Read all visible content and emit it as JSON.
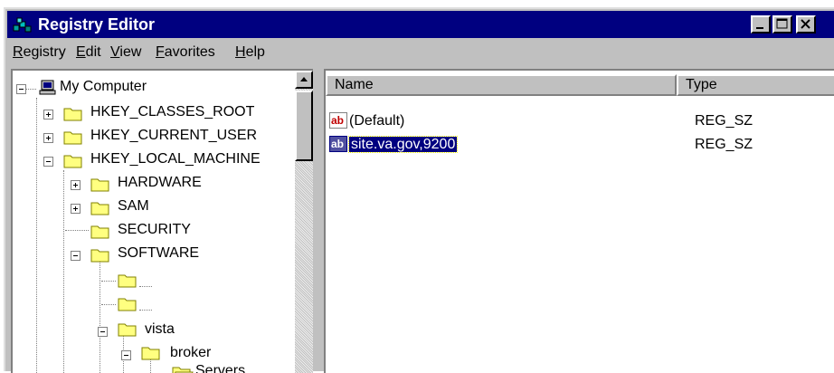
{
  "window": {
    "title": "Registry Editor",
    "app_icon": "registry-editor-icon"
  },
  "title_buttons": [
    "minimize-icon",
    "maximize-icon",
    "close-icon"
  ],
  "menu": [
    {
      "pre": "",
      "u": "R",
      "post": "egistry"
    },
    {
      "pre": "",
      "u": "E",
      "post": "dit"
    },
    {
      "pre": "",
      "u": "V",
      "post": "iew"
    },
    {
      "pre": "",
      "u": "F",
      "post": "avorites"
    },
    {
      "pre": "",
      "u": "H",
      "post": "elp"
    }
  ],
  "tree": {
    "root": {
      "label": "My Computer",
      "icon": "computer-icon",
      "toggle": "minus"
    },
    "nodes": [
      {
        "label": "HKEY_CLASSES_ROOT",
        "toggle": "plus",
        "icon": "folder-icon"
      },
      {
        "label": "HKEY_CURRENT_USER",
        "toggle": "plus",
        "icon": "folder-icon"
      },
      {
        "label": "HKEY_LOCAL_MACHINE",
        "toggle": "minus",
        "icon": "folder-icon"
      },
      {
        "label": "HARDWARE",
        "toggle": "plus",
        "icon": "folder-icon"
      },
      {
        "label": "SAM",
        "toggle": "plus",
        "icon": "folder-icon"
      },
      {
        "label": "SECURITY",
        "toggle": "none",
        "icon": "folder-icon"
      },
      {
        "label": "SOFTWARE",
        "toggle": "minus",
        "icon": "folder-icon"
      },
      {
        "label": "",
        "toggle": "none",
        "icon": "folder-icon"
      },
      {
        "label": "",
        "toggle": "none",
        "icon": "folder-icon"
      },
      {
        "label": "vista",
        "toggle": "minus",
        "icon": "folder-icon"
      },
      {
        "label": "broker",
        "toggle": "minus",
        "icon": "folder-icon"
      },
      {
        "label": "Servers",
        "toggle": "none",
        "icon": "open-folder-icon"
      }
    ]
  },
  "columns": {
    "name": "Name",
    "type": "Type"
  },
  "values": [
    {
      "name": "(Default)",
      "type": "REG_SZ",
      "icon": "string-value-icon",
      "selected": false
    },
    {
      "name": "site.va.gov,9200",
      "type": "REG_SZ",
      "icon": "string-value-icon",
      "selected": true
    }
  ]
}
